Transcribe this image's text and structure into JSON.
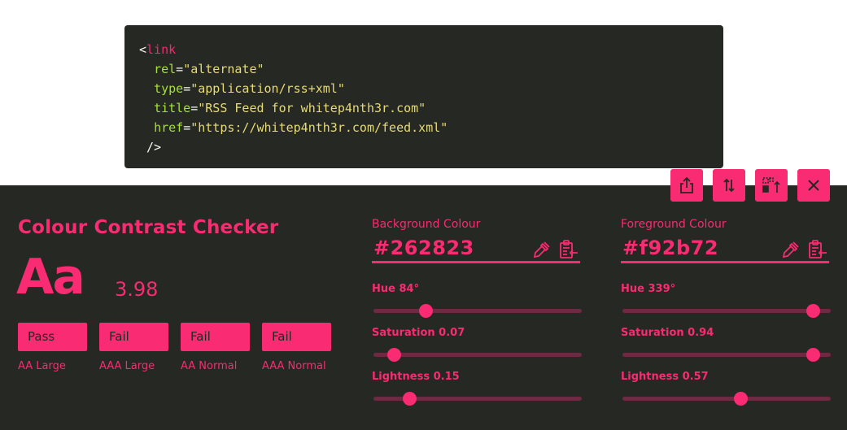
{
  "code": {
    "lines": [
      [
        {
          "t": "punc",
          "v": "<"
        },
        {
          "t": "tag",
          "v": "link"
        }
      ],
      [
        {
          "t": "punc",
          "v": "  "
        },
        {
          "t": "attr",
          "v": "rel"
        },
        {
          "t": "punc",
          "v": "="
        },
        {
          "t": "str",
          "v": "\"alternate\""
        }
      ],
      [
        {
          "t": "punc",
          "v": "  "
        },
        {
          "t": "attr",
          "v": "type"
        },
        {
          "t": "punc",
          "v": "="
        },
        {
          "t": "str",
          "v": "\"application/rss+xml\""
        }
      ],
      [
        {
          "t": "punc",
          "v": "  "
        },
        {
          "t": "attr",
          "v": "title"
        },
        {
          "t": "punc",
          "v": "="
        },
        {
          "t": "str",
          "v": "\"RSS Feed for whitep4nth3r.com\""
        }
      ],
      [
        {
          "t": "punc",
          "v": "  "
        },
        {
          "t": "attr",
          "v": "href"
        },
        {
          "t": "punc",
          "v": "="
        },
        {
          "t": "str",
          "v": "\"https://whitep4nth3r.com/feed.xml\""
        }
      ],
      [
        {
          "t": "punc",
          "v": " />"
        }
      ]
    ]
  },
  "toolbar": {
    "buttons": [
      {
        "name": "share-button",
        "icon": "share-icon"
      },
      {
        "name": "swap-colours-button",
        "icon": "swap-icon"
      },
      {
        "name": "move-panel-button",
        "icon": "move-panel-icon"
      },
      {
        "name": "close-button",
        "icon": "close-icon"
      }
    ]
  },
  "checker": {
    "title": "Colour Contrast Checker",
    "sample": "Aa",
    "ratio": "3.98",
    "results": [
      {
        "status": "Pass",
        "label": "AA Large"
      },
      {
        "status": "Fail",
        "label": "AAA Large"
      },
      {
        "status": "Fail",
        "label": "AA Normal"
      },
      {
        "status": "Fail",
        "label": "AAA Normal"
      }
    ]
  },
  "background": {
    "label": "Background Colour",
    "hex": "#262823",
    "hue_label": "Hue 84°",
    "hue": 84,
    "saturation_label": "Saturation 0.07",
    "saturation": 0.07,
    "lightness_label": "Lightness 0.15",
    "lightness": 0.15
  },
  "foreground": {
    "label": "Foreground Colour",
    "hex": "#f92b72",
    "hue_label": "Hue 339°",
    "hue": 339,
    "saturation_label": "Saturation 0.94",
    "saturation": 0.94,
    "lightness_label": "Lightness 0.57",
    "lightness": 0.57
  },
  "colors": {
    "accent": "#f92b72",
    "panel": "#262823",
    "track": "#6e2a43"
  }
}
